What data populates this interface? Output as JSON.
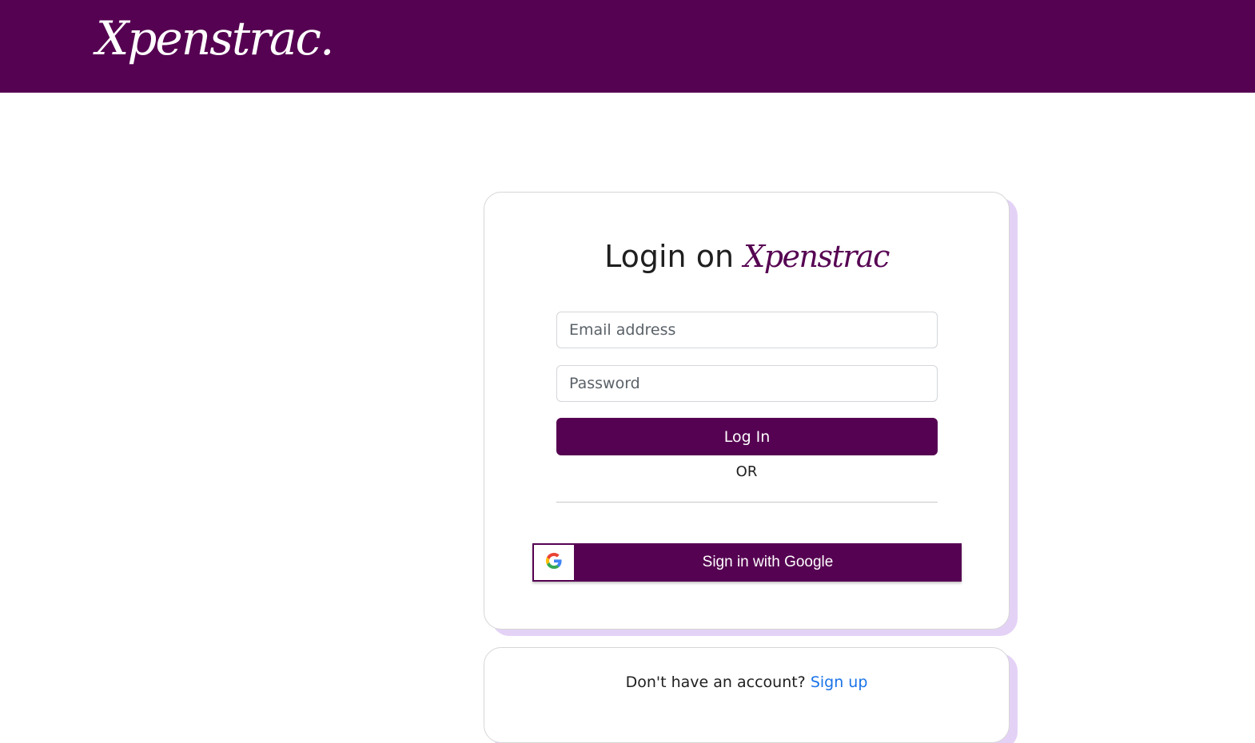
{
  "header": {
    "brand": "Xpenstrac."
  },
  "login": {
    "title_prefix": "Login on",
    "title_brand": "Xpenstrac",
    "email_placeholder": "Email address",
    "password_placeholder": "Password",
    "login_button": "Log In",
    "or_text": "OR",
    "google_button": "Sign in with Google"
  },
  "signup": {
    "prompt": "Don't have an account?",
    "link": "Sign up"
  },
  "colors": {
    "brand": "#560252",
    "link": "#1a73e8",
    "card_shadow": "#e4d2f6"
  },
  "icons": {
    "google": "google-g-icon"
  }
}
